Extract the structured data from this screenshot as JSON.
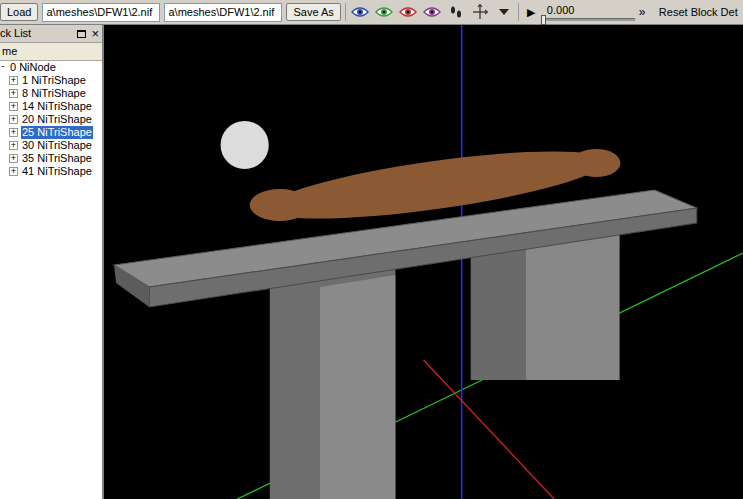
{
  "toolbar": {
    "load_button": "Load",
    "file_fields": [
      "a\\meshes\\DFW1\\2.nif",
      "a\\meshes\\DFW1\\2.nif"
    ],
    "save_button": "Save As",
    "view_icons": [
      {
        "color": "#2f4fb0"
      },
      {
        "color": "#3a9a3a"
      },
      {
        "color": "#c03030"
      },
      {
        "color": "#8a3a8a"
      }
    ],
    "time": {
      "play": "▶",
      "reading": "0.000",
      "level": 0
    },
    "more": "»",
    "reset_button": "Reset Block Det"
  },
  "block_list": {
    "title": "ck List",
    "close": "×",
    "column": "me",
    "items": [
      {
        "label": "0 NiNode",
        "expander": "-",
        "expanded": true,
        "selected": false,
        "kind": "root"
      },
      {
        "label": "1 NiTriShape",
        "expander": "+",
        "expanded": false,
        "selected": false,
        "kind": "child"
      },
      {
        "label": "8 NiTriShape",
        "expander": "+",
        "expanded": false,
        "selected": false,
        "kind": "child"
      },
      {
        "label": "14 NiTriShape",
        "expander": "+",
        "expanded": false,
        "selected": false,
        "kind": "child"
      },
      {
        "label": "20 NiTriShape",
        "expander": "+",
        "expanded": false,
        "selected": false,
        "kind": "child"
      },
      {
        "label": "25 NiTriShape",
        "expander": "+",
        "expanded": false,
        "selected": true,
        "kind": "child"
      },
      {
        "label": "30 NiTriShape",
        "expander": "+",
        "expanded": false,
        "selected": false,
        "kind": "child"
      },
      {
        "label": "35 NiTriShape",
        "expander": "+",
        "expanded": false,
        "selected": false,
        "kind": "child"
      },
      {
        "label": "41 NiTriShape",
        "expander": "+",
        "expanded": false,
        "selected": false,
        "kind": "child"
      }
    ]
  }
}
